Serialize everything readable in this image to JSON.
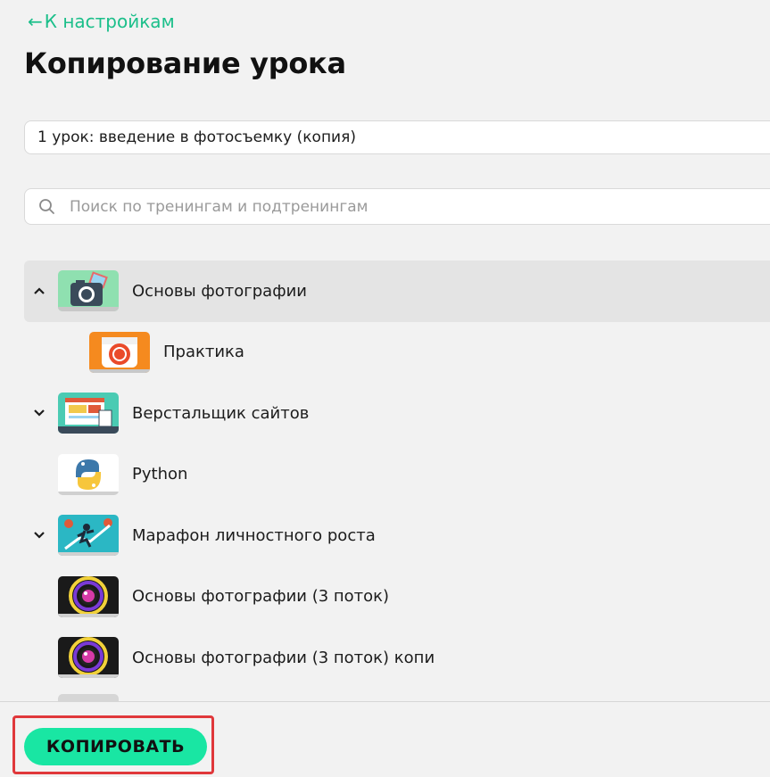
{
  "nav": {
    "back_label": "К настройкам"
  },
  "header": {
    "title": "Копирование урока"
  },
  "lesson": {
    "name_value": "1 урок: введение в фотосъемку (копия)"
  },
  "search": {
    "placeholder": "Поиск по тренингам и подтренингам"
  },
  "tree": {
    "items": [
      {
        "label": "Основы фотографии",
        "chevron": "up",
        "level": 0,
        "selected": true,
        "icon": "camera-photo-icon"
      },
      {
        "label": "Практика",
        "chevron": "none",
        "level": 1,
        "selected": false,
        "icon": "orange-camera-icon"
      },
      {
        "label": "Верстальщик сайтов",
        "chevron": "down",
        "level": 0,
        "selected": false,
        "icon": "web-layout-icon"
      },
      {
        "label": "Python",
        "chevron": "none",
        "level": 0,
        "selected": false,
        "icon": "python-logo-icon"
      },
      {
        "label": "Марафон личностного роста",
        "chevron": "down",
        "level": 0,
        "selected": false,
        "icon": "growth-runner-icon"
      },
      {
        "label": "Основы фотографии (3 поток)",
        "chevron": "none",
        "level": 0,
        "selected": false,
        "icon": "lens-swirl-icon"
      },
      {
        "label": "Основы фотографии (3 поток) копи",
        "chevron": "none",
        "level": 0,
        "selected": false,
        "icon": "lens-swirl-icon"
      }
    ]
  },
  "footer": {
    "copy_label": "КОПИРОВАТЬ"
  },
  "colors": {
    "accent": "#19e6a3",
    "link": "#1bbf8a",
    "highlight": "#e0383b"
  }
}
